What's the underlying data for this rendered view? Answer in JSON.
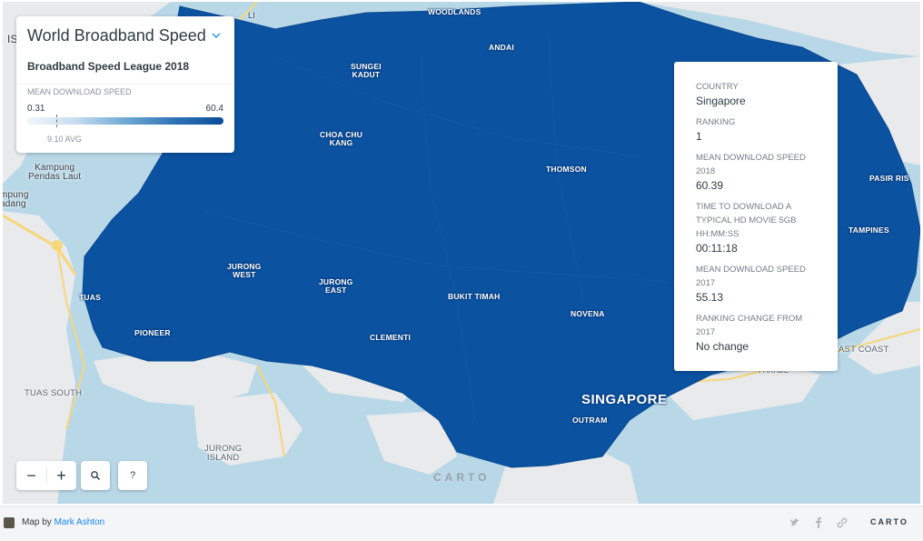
{
  "map": {
    "place_labels": {
      "woodlands": "WOODLANDS",
      "sembawang": "ANDAI",
      "sungei_kadut": "SUNGEI\nKADUT",
      "choa_chu_kang": "CHOA CHU\nKANG",
      "thomson": "THOMSON",
      "pasir_ris": "PASIR RIS",
      "tampines": "TAMPINES",
      "jurong_west": "JURONG\nWEST",
      "jurong_east": "JURONG\nEAST",
      "bukit_timah": "BUKIT TIMAH",
      "novena": "NOVENA",
      "tuas": "TUAS",
      "pioneer": "PIONEER",
      "clementi": "CLEMENTI",
      "east_coast": "AST COAST",
      "parade": "PARADE",
      "singapore": "SINGAPORE",
      "outram": "OUTRAM",
      "kampung_pendas_laut": "Kampung\nPendas Laut",
      "kampung_edge": "mpung\nadang",
      "tuas_south": "TUAS SOUTH",
      "jurong_island": "JURONG\nISLAND",
      "is_edge": "IS",
      "li_edge": "LI"
    },
    "watermark": "CARTO",
    "colors": {
      "country_fill": "#0b52a0",
      "water": "#b8d8e8",
      "land": "#e8eaec",
      "road": "#f6d77a"
    }
  },
  "legend": {
    "title": "World Broadband Speed",
    "subtitle": "Broadband Speed League 2018",
    "metric_label": "MEAN DOWNLOAD SPEED",
    "min": "0.31",
    "max": "60.4",
    "avg_label": "9.10 AVG",
    "toggle_icon": "chevron-down-icon"
  },
  "info": {
    "country_label": "COUNTRY",
    "country": "Singapore",
    "ranking_label": "RANKING",
    "ranking": "1",
    "speed2018_label": "MEAN DOWNLOAD SPEED 2018",
    "speed2018": "60.39",
    "movie_label": "TIME TO DOWNLOAD A TYPICAL HD MOVIE 5GB HH:MM:SS",
    "movie_time": "00:11:18",
    "speed2017_label": "MEAN DOWNLOAD SPEED 2017",
    "speed2017": "55.13",
    "change_label": "RANKING CHANGE FROM 2017",
    "change": "No change"
  },
  "controls": {
    "zoom_out": "−",
    "zoom_in": "+",
    "help": "?",
    "search_icon": "search-icon"
  },
  "footer": {
    "map_by": "Map by",
    "author": "Mark Ashton",
    "brand": "CARTO",
    "icons": [
      "twitter-icon",
      "facebook-icon",
      "link-icon"
    ]
  }
}
